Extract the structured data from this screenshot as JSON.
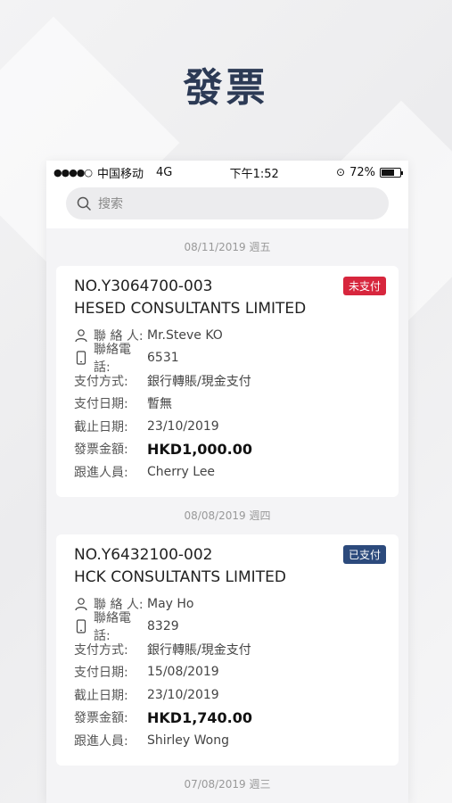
{
  "promo": {
    "title": "發票"
  },
  "status_bar": {
    "carrier": "中国移动",
    "network": "4G",
    "time": "下午1:52",
    "battery": "72%",
    "battery_level": 0.72
  },
  "search": {
    "placeholder": "搜索"
  },
  "invoices": [
    {
      "date": "08/11/2019 週五",
      "number": "NO.Y3064700-003",
      "company": "HESED CONSULTANTS LIMITED",
      "status": "未支付",
      "status_color": "#d7263d",
      "contact_label": "聯 絡 人:",
      "contact": "Mr.Steve KO",
      "phone_label": "聯絡電話:",
      "phone": "6531",
      "payment_method_label": "支付方式:",
      "payment_method": "銀行轉賬/現金支付",
      "payment_date_label": "支付日期:",
      "payment_date": "暫無",
      "due_date_label": "截止日期:",
      "due_date": "23/10/2019",
      "amount_label": "發票金額:",
      "amount": "HKD1,000.00",
      "follow_up_label": "跟進人員:",
      "follow_up": "Cherry Lee"
    },
    {
      "date": "08/08/2019 週四",
      "number": "NO.Y6432100-002",
      "company": "HCK CONSULTANTS LIMITED",
      "status": "已支付",
      "status_color": "#2c4a7c",
      "contact_label": "聯 絡 人:",
      "contact": "May Ho",
      "phone_label": "聯絡電話:",
      "phone": "8329",
      "payment_method_label": "支付方式:",
      "payment_method": "銀行轉賬/現金支付",
      "payment_date_label": "支付日期:",
      "payment_date": "15/08/2019",
      "due_date_label": "截止日期:",
      "due_date": "23/10/2019",
      "amount_label": "發票金額:",
      "amount": "HKD1,740.00",
      "follow_up_label": "跟進人員:",
      "follow_up": "Shirley Wong"
    }
  ],
  "next_date": "07/08/2019 週三"
}
